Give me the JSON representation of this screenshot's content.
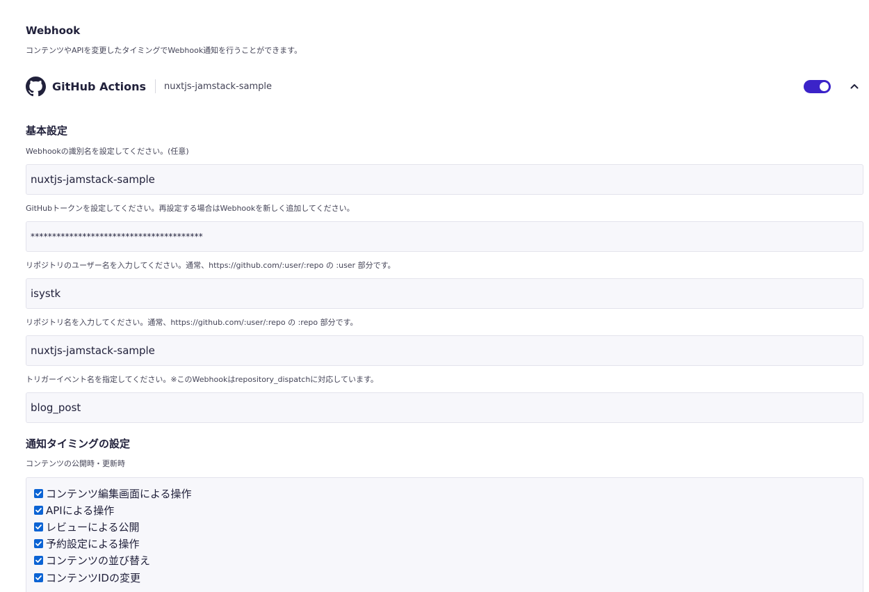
{
  "header": {
    "title": "Webhook",
    "description": "コンテンツやAPIを変更したタイミングでWebhook通知を行うことができます。"
  },
  "service": {
    "icon": "github-icon",
    "name": "GitHub Actions",
    "identifier": "nuxtjs-jamstack-sample",
    "enabled": true,
    "toggle_color": "#3b23c8"
  },
  "basic_settings": {
    "title": "基本設定",
    "fields": [
      {
        "label": "Webhookの識別名を設定してください。(任意)",
        "value": "nuxtjs-jamstack-sample"
      },
      {
        "label": "GitHubトークンを設定してください。再設定する場合はWebhookを新しく追加してください。",
        "value": "****************************************"
      },
      {
        "label": "リポジトリのユーザー名を入力してください。通常、https://github.com/:user/:repo の :user 部分です。",
        "value": "isystk"
      },
      {
        "label": "リポジトリ名を入力してください。通常、https://github.com/:user/:repo の :repo 部分です。",
        "value": "nuxtjs-jamstack-sample"
      },
      {
        "label": "トリガーイベント名を指定してください。※このWebhookはrepository_dispatchに対応しています。",
        "value": "blog_post"
      }
    ]
  },
  "notification": {
    "title": "通知タイミングの設定",
    "subtitle": "コンテンツの公開時・更新時",
    "checkbox_color": "#0b63d4",
    "options": [
      {
        "label": "コンテンツ編集画面による操作",
        "checked": true
      },
      {
        "label": "APIによる操作",
        "checked": true
      },
      {
        "label": "レビューによる公開",
        "checked": true
      },
      {
        "label": "予約設定による操作",
        "checked": true
      },
      {
        "label": "コンテンツの並び替え",
        "checked": true
      },
      {
        "label": "コンテンツIDの変更",
        "checked": true
      }
    ]
  }
}
